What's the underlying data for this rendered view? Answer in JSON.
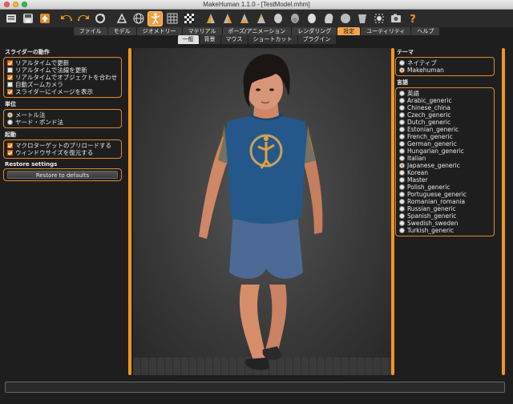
{
  "window": {
    "title": "MakeHuman 1.1.0 - [TestModel.mhm]"
  },
  "toolbar": {
    "icons": [
      "undo-history-icon",
      "save-icon",
      "export-icon",
      "undo-icon",
      "redo-icon",
      "reset-icon",
      "smooth-icon",
      "wireframe-icon",
      "pose-icon",
      "grid-icon",
      "checker-icon",
      "front-view-icon",
      "back-view-icon",
      "left-view-icon",
      "right-view-icon",
      "top-view-icon",
      "bottom-view-icon",
      "reset-camera-icon",
      "screenshot-icon",
      "help-icon"
    ],
    "selected": [
      "pose-icon"
    ]
  },
  "main_tabs": [
    "ファイル",
    "モデル",
    "ジオメトリー",
    "マテリアル",
    "ポーズ/アニメーション",
    "レンダリング",
    "設定",
    "ユーティリティ",
    "ヘルプ"
  ],
  "main_tab_active": "設定",
  "sub_tabs": [
    "一般",
    "背景",
    "マウス",
    "ショートカット",
    "プラグイン"
  ],
  "sub_tab_active": "一般",
  "left": {
    "slider_title": "スライダーの動作",
    "slider_options": [
      {
        "label": "リアルタイムで更新",
        "checked": true
      },
      {
        "label": "リアルタイムで法線を更新",
        "checked": false
      },
      {
        "label": "リアルタイムでオブジェクトを合わせる",
        "checked": true
      },
      {
        "label": "自動ズームカメラ",
        "checked": false
      },
      {
        "label": "スライダーにイメージを表示",
        "checked": true
      }
    ],
    "units_title": "単位",
    "units_options": [
      {
        "label": "メートル法",
        "checked": true
      },
      {
        "label": "ヤード・ポンド法",
        "checked": false
      }
    ],
    "startup_title": "起動",
    "startup_options": [
      {
        "label": "マクロターゲットのプリロードする",
        "checked": true
      },
      {
        "label": "ウィンドウサイズを復元する",
        "checked": true
      }
    ],
    "restore_title": "Restore settings",
    "restore_button": "Restore to defaults"
  },
  "right": {
    "theme_title": "テーマ",
    "theme_options": [
      {
        "label": "ネイティブ",
        "checked": false
      },
      {
        "label": "Makehuman",
        "checked": true
      }
    ],
    "language_title": "言語",
    "languages": [
      {
        "label": "英語",
        "checked": false
      },
      {
        "label": "Arabic_generic",
        "checked": false
      },
      {
        "label": "Chinese_china",
        "checked": false
      },
      {
        "label": "Czech_generic",
        "checked": false
      },
      {
        "label": "Dutch_generic",
        "checked": false
      },
      {
        "label": "Estonian_generic",
        "checked": false
      },
      {
        "label": "French_generic",
        "checked": false
      },
      {
        "label": "German_generic",
        "checked": false
      },
      {
        "label": "Hungarian_generic",
        "checked": false
      },
      {
        "label": "Italian",
        "checked": false
      },
      {
        "label": "Japanese_generic",
        "checked": true
      },
      {
        "label": "Korean",
        "checked": false
      },
      {
        "label": "Master",
        "checked": false
      },
      {
        "label": "Polish_generic",
        "checked": false
      },
      {
        "label": "Portuguese_generic",
        "checked": false
      },
      {
        "label": "Romanian_romania",
        "checked": false
      },
      {
        "label": "Russian_generic",
        "checked": false
      },
      {
        "label": "Spanish_generic",
        "checked": false
      },
      {
        "label": "Swedish_sweden",
        "checked": false
      },
      {
        "label": "Turkish_generic",
        "checked": false
      }
    ]
  },
  "colors": {
    "accent": "#f0961e",
    "background": "#1e1e1e",
    "tab_active": "#f4a54c"
  }
}
